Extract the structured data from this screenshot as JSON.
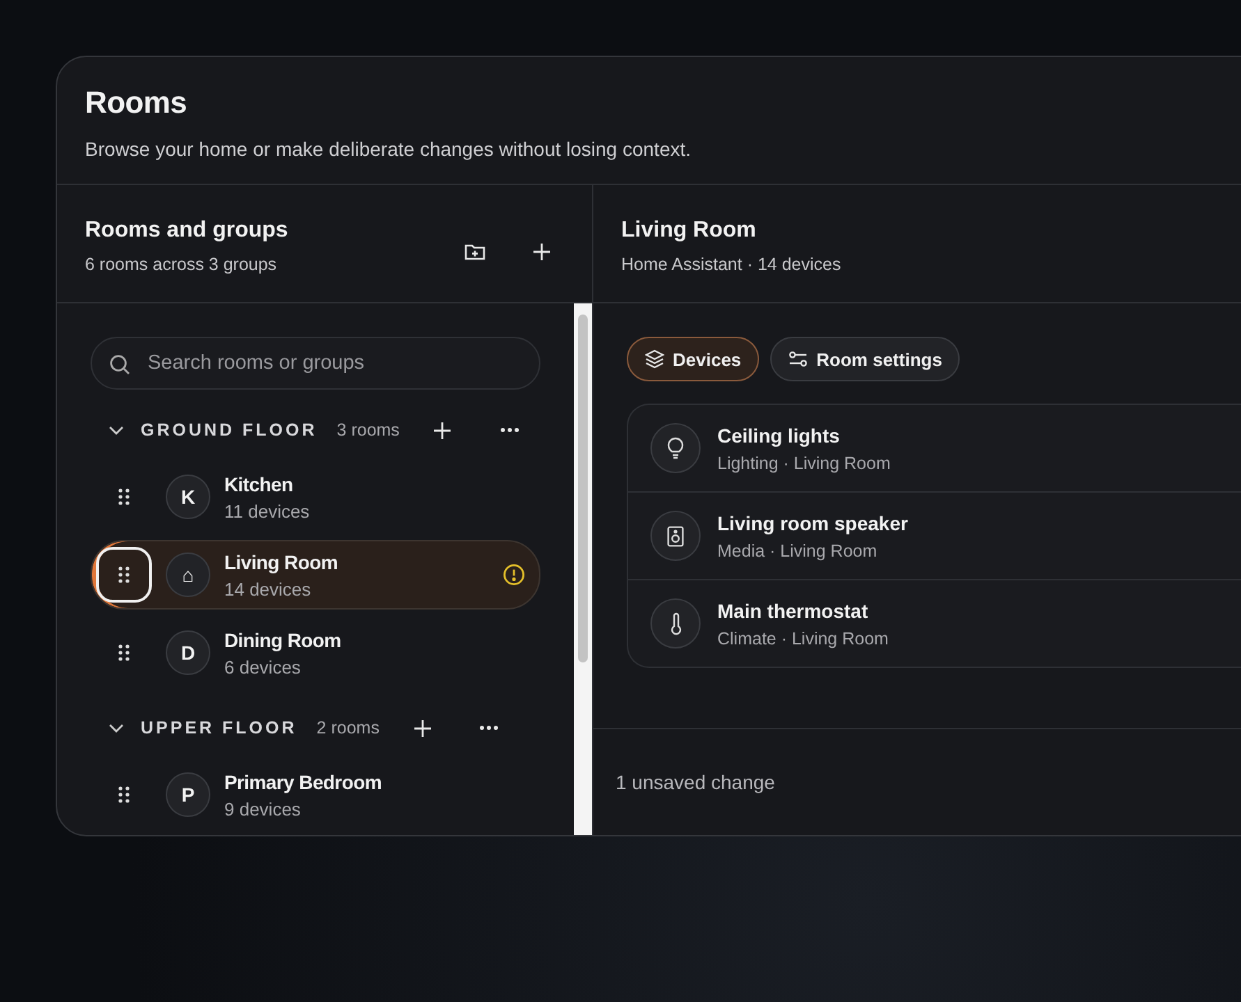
{
  "window": {
    "title": "Rooms",
    "subtitle": "Browse your home or make deliberate changes without losing context."
  },
  "sidebar": {
    "title": "Rooms and groups",
    "subtitle": "6 rooms across 3 groups",
    "search": {
      "placeholder": "Search rooms or groups"
    },
    "groups": [
      {
        "name": "GROUND FLOOR",
        "count": "3 rooms",
        "expanded": true,
        "rooms": [
          {
            "name": "Kitchen",
            "devices": "11 devices",
            "avatar": "K",
            "selected": false,
            "handle_focused": false,
            "warning": false
          },
          {
            "name": "Living Room",
            "devices": "14 devices",
            "avatar": "⌂",
            "selected": true,
            "handle_focused": true,
            "warning": true
          },
          {
            "name": "Dining Room",
            "devices": "6 devices",
            "avatar": "D",
            "selected": false,
            "handle_focused": false,
            "warning": false
          }
        ]
      },
      {
        "name": "UPPER FLOOR",
        "count": "2 rooms",
        "expanded": true,
        "rooms": [
          {
            "name": "Primary Bedroom",
            "devices": "9 devices",
            "avatar": "P",
            "selected": false,
            "handle_focused": false,
            "warning": false
          }
        ]
      }
    ]
  },
  "detail": {
    "title": "Living Room",
    "subtitle": "Home Assistant · 14 devices",
    "tabs": [
      {
        "label": "Devices",
        "selected": true
      },
      {
        "label": "Room settings",
        "selected": false
      }
    ],
    "devices": [
      {
        "name": "Ceiling lights",
        "meta": "Lighting · Living Room",
        "kind": "bulb"
      },
      {
        "name": "Living room speaker",
        "meta": "Media · Living Room",
        "kind": "speaker"
      },
      {
        "name": "Main thermostat",
        "meta": "Climate · Living Room",
        "kind": "thermometer"
      }
    ],
    "status": "1 unsaved change"
  }
}
